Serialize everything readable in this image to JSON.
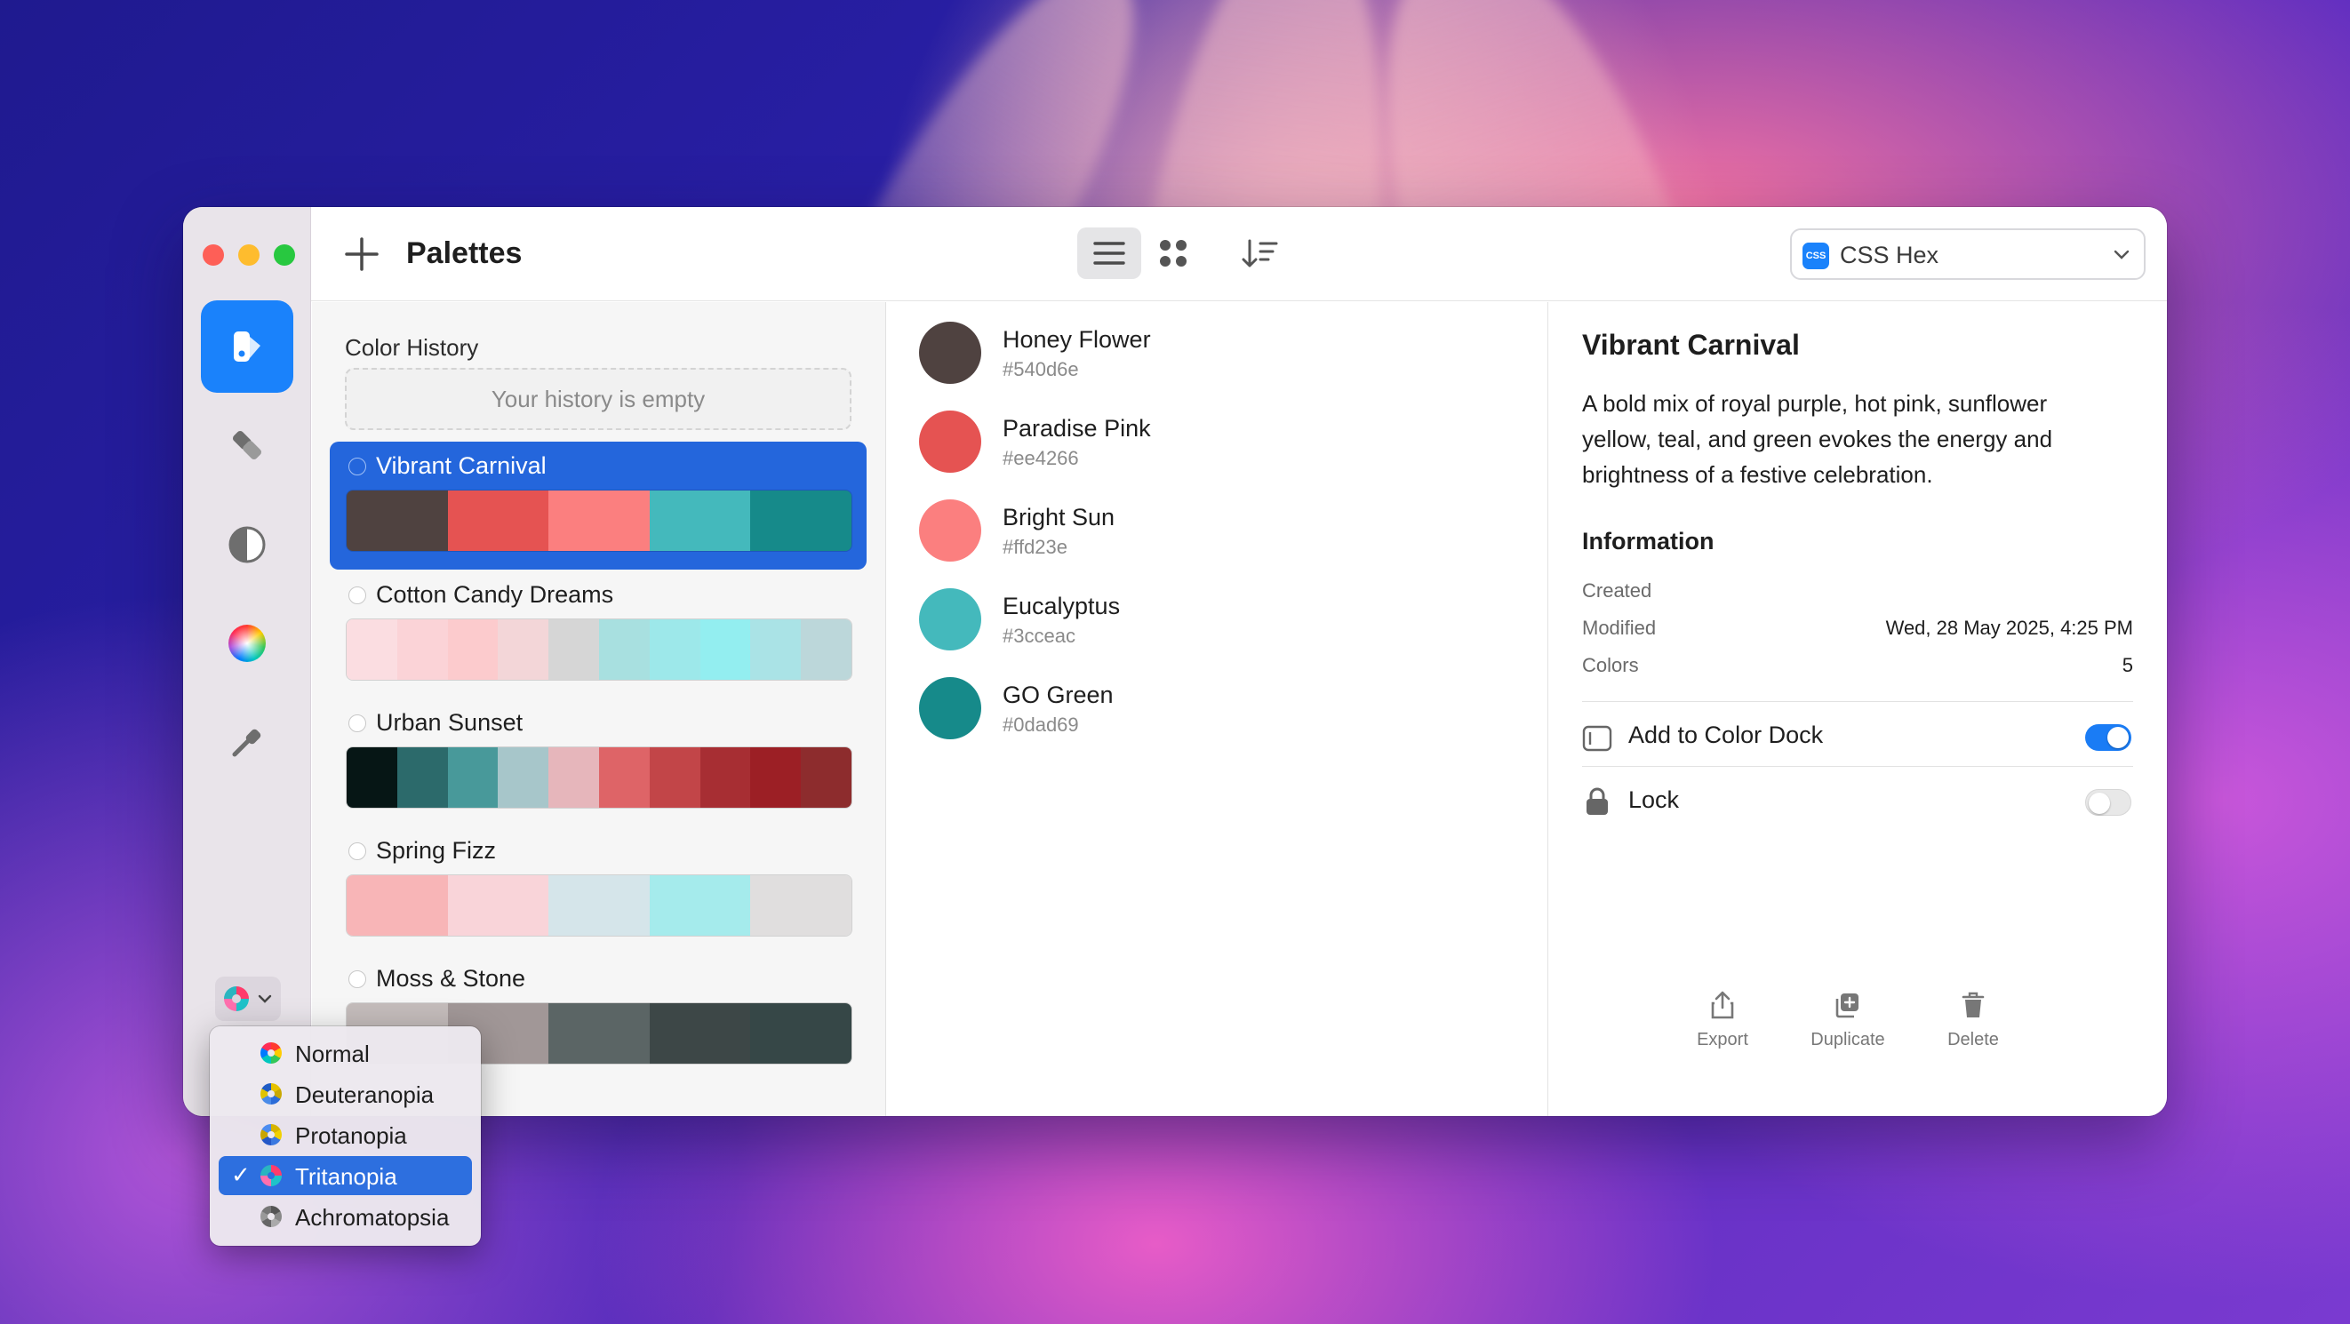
{
  "app": {
    "title": "Palettes",
    "format_select": {
      "value": "CSS Hex",
      "badge": "CSS"
    }
  },
  "rail": {
    "items": [
      {
        "name": "palettes",
        "active": true
      },
      {
        "name": "collections",
        "active": false
      },
      {
        "name": "contrast",
        "active": false
      },
      {
        "name": "color-wheel",
        "active": false
      },
      {
        "name": "picker",
        "active": false
      }
    ]
  },
  "sidebar": {
    "history_title": "Color History",
    "history_empty": "Your history is empty",
    "palettes": [
      {
        "name": "Vibrant Carnival",
        "selected": true,
        "colors": [
          "#540d6e",
          "#ee4266",
          "#ffd23e",
          "#3cceac",
          "#0dad69"
        ],
        "display": [
          "#4f4240",
          "#e55352",
          "#fb7f7f",
          "#44b9bc",
          "#168a8a"
        ]
      },
      {
        "name": "Cotton Candy Dreams",
        "selected": false,
        "display": [
          "#fbdde1",
          "#fbd3d7",
          "#fccbcd",
          "#f3d6d8",
          "#d6d6d6",
          "#a8e0e0",
          "#9de8ea",
          "#93eef0",
          "#aae3e6",
          "#bcd7da"
        ]
      },
      {
        "name": "Urban Sunset",
        "selected": false,
        "display": [
          "#061615",
          "#2c6a6b",
          "#48999a",
          "#a7c6ca",
          "#e6b6bb",
          "#de6467",
          "#c24548",
          "#a72e33",
          "#9c1f25",
          "#8d2c2d"
        ]
      },
      {
        "name": "Spring Fizz",
        "selected": false,
        "display": [
          "#f8b5b7",
          "#f9d4d9",
          "#d5e5ea",
          "#a5ebec",
          "#e0dede"
        ]
      },
      {
        "name": "Moss & Stone",
        "selected": false,
        "display": [
          "#c4bcbb",
          "#a19797",
          "#5b6565",
          "#3d4747",
          "#364747"
        ]
      }
    ]
  },
  "colors": [
    {
      "name": "Honey Flower",
      "hex": "#540d6e",
      "display": "#4f4240"
    },
    {
      "name": "Paradise Pink",
      "hex": "#ee4266",
      "display": "#e55352"
    },
    {
      "name": "Bright Sun",
      "hex": "#ffd23e",
      "display": "#fb7f7f"
    },
    {
      "name": "Eucalyptus",
      "hex": "#3cceac",
      "display": "#44b9bc"
    },
    {
      "name": "GO Green",
      "hex": "#0dad69",
      "display": "#168a8a"
    }
  ],
  "detail": {
    "title": "Vibrant Carnival",
    "description": "A bold mix of royal purple, hot pink, sunflower yellow, teal, and green evokes the energy and brightness of a festive celebration.",
    "info_title": "Information",
    "created_label": "Created",
    "created_value": "",
    "modified_label": "Modified",
    "modified_value": "Wed, 28 May 2025, 4:25 PM",
    "colors_label": "Colors",
    "colors_value": "5",
    "dock_label": "Add to Color Dock",
    "dock_on": true,
    "lock_label": "Lock",
    "lock_on": false,
    "actions": {
      "export": "Export",
      "duplicate": "Duplicate",
      "delete": "Delete"
    }
  },
  "vision_menu": {
    "items": [
      {
        "label": "Normal",
        "selected": false
      },
      {
        "label": "Deuteranopia",
        "selected": false
      },
      {
        "label": "Protanopia",
        "selected": false
      },
      {
        "label": "Tritanopia",
        "selected": true
      },
      {
        "label": "Achromatopsia",
        "selected": false
      }
    ]
  },
  "theme": {
    "accent": "#1a82fb",
    "selection": "#2466dc"
  }
}
